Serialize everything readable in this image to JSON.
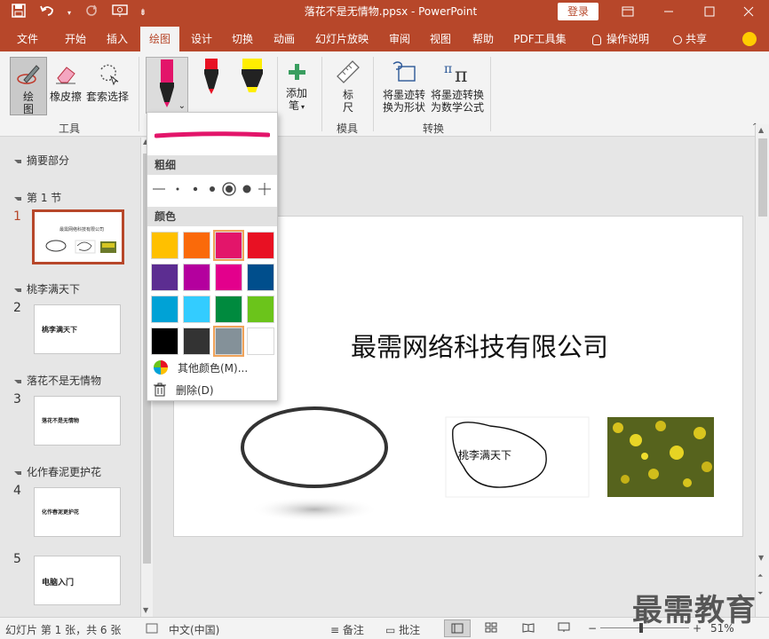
{
  "title_bar": {
    "doc_title": "落花不是无情物.ppsx  -  PowerPoint",
    "login_label": "登录"
  },
  "tabs": [
    "文件",
    "开始",
    "插入",
    "绘图",
    "设计",
    "切换",
    "动画",
    "幻灯片放映",
    "审阅",
    "视图",
    "帮助",
    "PDF工具集"
  ],
  "tab_active": "绘图",
  "tell_me": "操作说明",
  "share": "共享",
  "ribbon": {
    "draw_label_1": "绘",
    "draw_label_2": "图",
    "eraser_label": "橡皮擦",
    "lasso_label": "套索选择",
    "group_tools": "工具",
    "add_pen_label_1": "添加",
    "add_pen_label_2": "笔",
    "ruler_label_1": "标",
    "ruler_label_2": "尺",
    "group_stencils": "模具",
    "ink_to_shape_1": "将墨迹转",
    "ink_to_shape_2": "换为形状",
    "ink_to_math_1": "将墨迹转换",
    "ink_to_math_2": "为数学公式",
    "group_convert": "转换"
  },
  "dropdown": {
    "thickness_header": "粗细",
    "color_header": "颜色",
    "more_colors": "其他颜色(M)...",
    "delete": "删除(D)",
    "pen_preview_color": "#e3156a",
    "colors": [
      "#ffc000",
      "#fa6a0a",
      "#e3156a",
      "#e81123",
      "#5c2d91",
      "#b4009e",
      "#e3008c",
      "#004e8c",
      "#00a2d6",
      "#33ccff",
      "#008a3e",
      "#6bc41b",
      "#000000",
      "#333333",
      "#849199",
      "#ffffff"
    ],
    "selected_color_indices": [
      2,
      14
    ]
  },
  "slides_panel": {
    "sections": [
      {
        "title": "摘要部分"
      },
      {
        "title": "第 1 节"
      },
      {
        "title": "桃李满天下"
      },
      {
        "title": "落花不是无情物"
      },
      {
        "title": "化作春泥更护花"
      }
    ],
    "slides": [
      {
        "num": "1",
        "text": "最需网络科技有限公司"
      },
      {
        "num": "2",
        "text": "桃李满天下"
      },
      {
        "num": "3",
        "text": "落花不是无情物"
      },
      {
        "num": "4",
        "text": "化作春泥更护花"
      },
      {
        "num": "5",
        "text": "电脑入门"
      }
    ]
  },
  "slide": {
    "title": "最需网络科技有限公司",
    "ink_text": "桃李满天下"
  },
  "status": {
    "slide_info": "幻灯片 第 1 张，共 6 张",
    "language": "中文(中国)",
    "notes": "备注",
    "comments": "批注",
    "zoom": "51%",
    "watermark": "最需教育"
  },
  "accent": "#b7472a"
}
